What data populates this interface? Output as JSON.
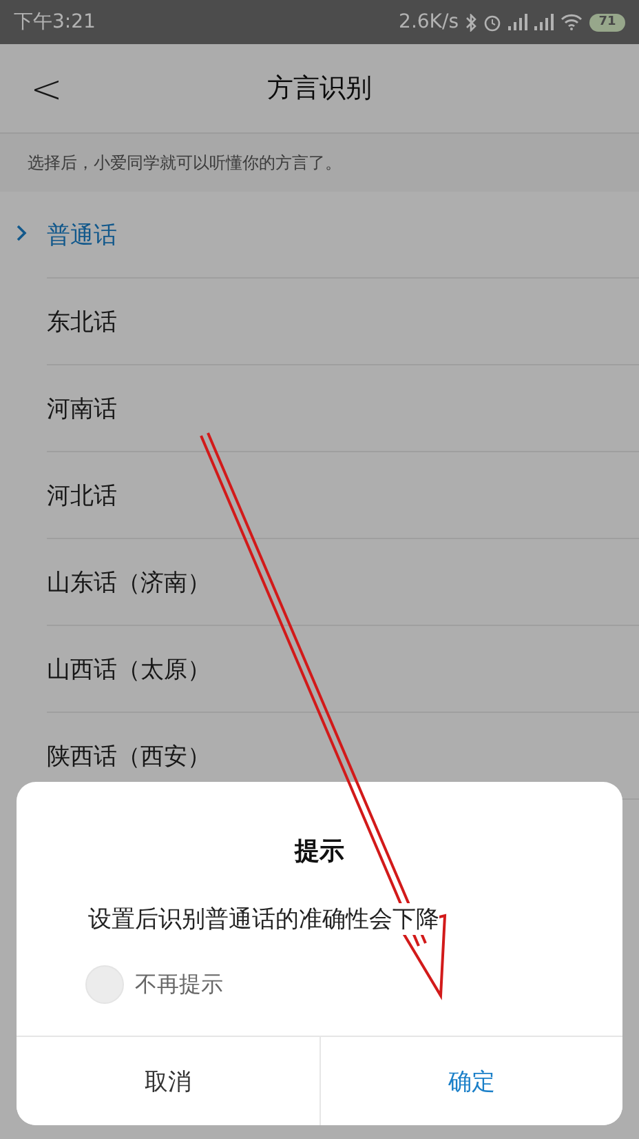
{
  "status_bar": {
    "time": "下午3:21",
    "speed": "2.6K/s",
    "battery": "71"
  },
  "header": {
    "back": "<",
    "title": "方言识别"
  },
  "hint": "选择后，小爱同学就可以听懂你的方言了。",
  "dialects": [
    {
      "label": "普通话",
      "selected": true
    },
    {
      "label": "东北话",
      "selected": false
    },
    {
      "label": "河南话",
      "selected": false
    },
    {
      "label": "河北话",
      "selected": false
    },
    {
      "label": "山东话（济南）",
      "selected": false
    },
    {
      "label": "山西话（太原）",
      "selected": false
    },
    {
      "label": "陕西话（西安）",
      "selected": false
    }
  ],
  "dialog": {
    "title": "提示",
    "message": "设置后识别普通话的准确性会下降",
    "option": {
      "label": "不再提示",
      "checked": false
    },
    "buttons": [
      {
        "label": "取消",
        "kind": "cancel"
      },
      {
        "label": "确定",
        "kind": "confirm"
      }
    ]
  }
}
